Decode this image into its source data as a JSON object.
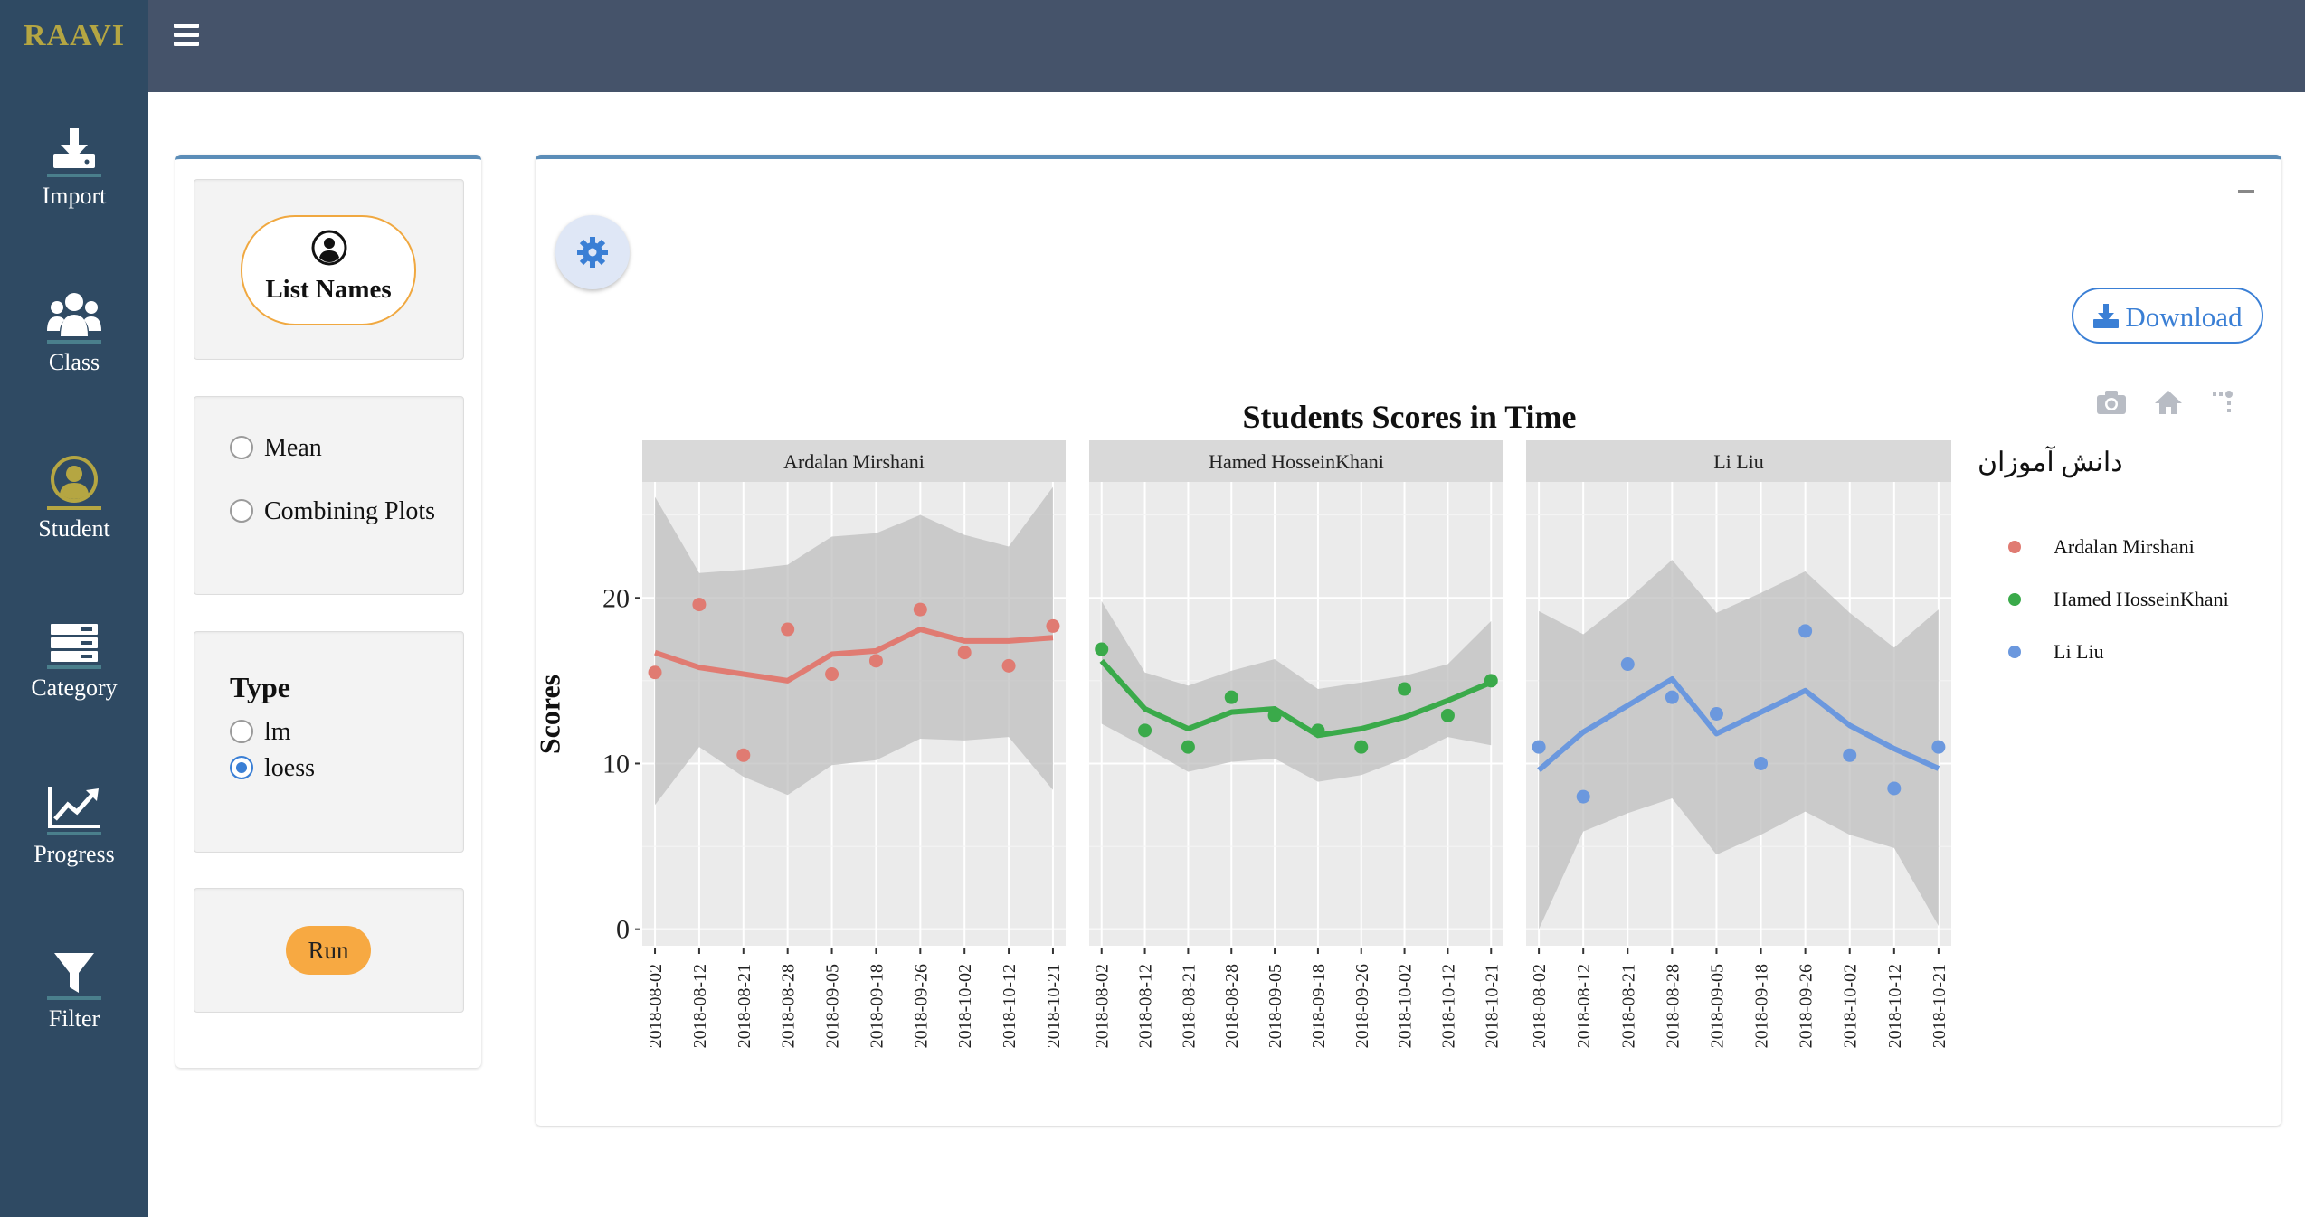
{
  "app": {
    "brand": "RAAVI"
  },
  "nav": {
    "items": [
      {
        "label": "Import",
        "icon": "download-tray-icon"
      },
      {
        "label": "Class",
        "icon": "users-icon"
      },
      {
        "label": "Student",
        "icon": "user-circle-icon"
      },
      {
        "label": "Category",
        "icon": "server-stack-icon"
      },
      {
        "label": "Progress",
        "icon": "line-chart-icon"
      },
      {
        "label": "Filter",
        "icon": "funnel-icon"
      }
    ],
    "active": "Student"
  },
  "controls": {
    "list_names_label": "List Names",
    "options": [
      {
        "label": "Mean",
        "checked": false
      },
      {
        "label": "Combining Plots",
        "checked": false
      }
    ],
    "type_title": "Type",
    "type_options": [
      {
        "label": "lm",
        "checked": false
      },
      {
        "label": "loess",
        "checked": true
      }
    ],
    "run_label": "Run"
  },
  "main": {
    "download_label": "Download",
    "legend_title": "دانش آموزان"
  },
  "colors": {
    "sidebar": "#2f4a63",
    "topbar": "#45536a",
    "accent": "#5b8db8",
    "brand": "#b5a642",
    "run": "#f7a942",
    "link": "#3a7fd5"
  },
  "chart_data": {
    "type": "scatter",
    "title": "Students Scores in Time",
    "xlabel": "",
    "ylabel": "Scores",
    "ylim": [
      -1,
      27
    ],
    "yticks": [
      0,
      10,
      20
    ],
    "x": [
      "2018-08-02",
      "2018-08-12",
      "2018-08-21",
      "2018-08-28",
      "2018-09-05",
      "2018-09-18",
      "2018-09-26",
      "2018-10-02",
      "2018-10-12",
      "2018-10-21"
    ],
    "smoother": "loess",
    "grid": true,
    "legend_position": "right",
    "series": [
      {
        "name": "Ardalan Mirshani",
        "color": "#e07b72",
        "values": [
          15.5,
          19.6,
          10.5,
          18.1,
          15.4,
          16.2,
          19.3,
          16.7,
          15.9,
          18.3
        ],
        "fit": [
          16.7,
          15.8,
          15.4,
          15.0,
          16.6,
          16.8,
          18.1,
          17.4,
          17.4,
          17.6
        ],
        "lower": [
          7.5,
          11.0,
          9.2,
          8.1,
          9.9,
          10.2,
          11.5,
          11.4,
          11.6,
          8.4
        ],
        "upper": [
          26.1,
          21.5,
          21.7,
          22.0,
          23.7,
          23.9,
          25.0,
          23.8,
          23.1,
          26.7
        ]
      },
      {
        "name": "Hamed HosseinKhani",
        "color": "#3aaa4a",
        "values": [
          16.9,
          12.0,
          11.0,
          14.0,
          12.9,
          12.0,
          11.0,
          14.5,
          12.9,
          15.0
        ],
        "fit": [
          16.2,
          13.3,
          12.1,
          13.1,
          13.3,
          11.7,
          12.1,
          12.8,
          13.8,
          14.9
        ],
        "lower": [
          12.4,
          11.0,
          9.5,
          10.1,
          10.3,
          8.9,
          9.3,
          10.3,
          11.6,
          11.1
        ],
        "upper": [
          19.8,
          15.5,
          14.7,
          15.6,
          16.3,
          14.5,
          14.9,
          15.3,
          16.0,
          18.6
        ]
      },
      {
        "name": "Li Liu",
        "color": "#6b98de",
        "values": [
          11.0,
          8.0,
          16.0,
          14.0,
          13.0,
          10.0,
          18.0,
          10.5,
          8.5,
          11.0
        ],
        "fit": [
          9.6,
          11.9,
          13.5,
          15.1,
          11.8,
          13.1,
          14.4,
          12.3,
          10.9,
          9.7
        ],
        "lower": [
          0.0,
          5.9,
          7.0,
          7.9,
          4.5,
          5.7,
          7.1,
          5.7,
          4.9,
          0.2
        ],
        "upper": [
          19.2,
          17.8,
          19.9,
          22.3,
          19.1,
          20.3,
          21.6,
          19.1,
          17.0,
          19.3
        ]
      }
    ]
  }
}
